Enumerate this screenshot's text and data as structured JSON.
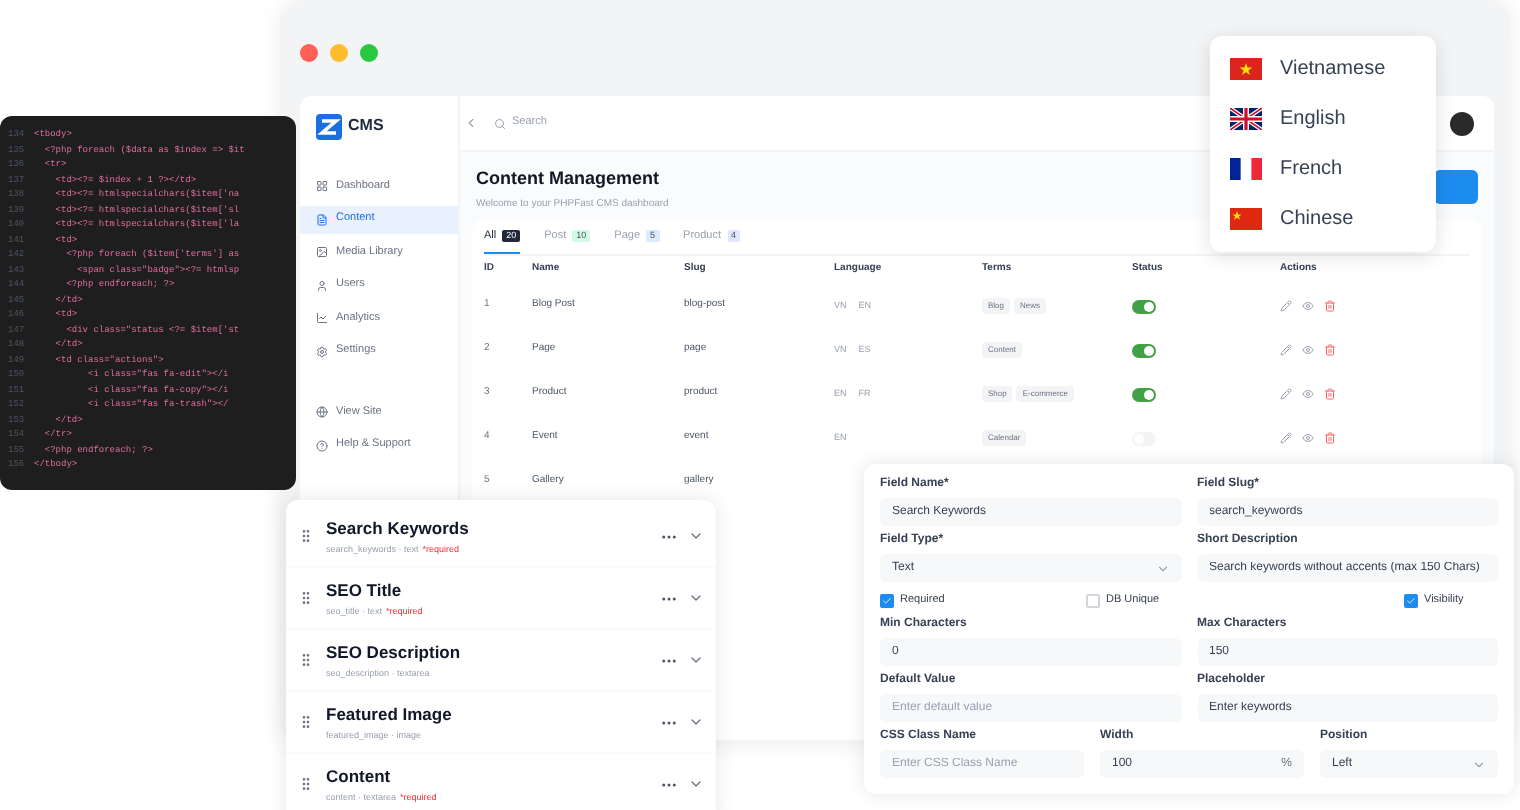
{
  "code_editor": {
    "lines": [
      {
        "number": "134",
        "text": "<tbody>"
      },
      {
        "number": "135",
        "text": "  <?php foreach ($data as $index => $it"
      },
      {
        "number": "136",
        "text": "  <tr>"
      },
      {
        "number": "137",
        "text": "    <td><?= $index + 1 ?></td>"
      },
      {
        "number": "138",
        "text": "    <td><?= htmlspecialchars($item['na"
      },
      {
        "number": "139",
        "text": "    <td><?= htmlspecialchars($item['sl"
      },
      {
        "number": "140",
        "text": "    <td><?= htmlspecialchars($item['la"
      },
      {
        "number": "141",
        "text": "    <td>"
      },
      {
        "number": "142",
        "text": "      <?php foreach ($item['terms'] as"
      },
      {
        "number": "143",
        "text": "        <span class=\"badge\"><?= htmlsp"
      },
      {
        "number": "144",
        "text": "      <?php endforeach; ?>"
      },
      {
        "number": "145",
        "text": "    </td>"
      },
      {
        "number": "146",
        "text": "    <td>"
      },
      {
        "number": "147",
        "text": "      <div class=\"status <?= $item['st"
      },
      {
        "number": "148",
        "text": "    </td>"
      },
      {
        "number": "149",
        "text": "    <td class=\"actions\">"
      },
      {
        "number": "150",
        "text": "          <i class=\"fas fa-edit\"></i"
      },
      {
        "number": "151",
        "text": "          <i class=\"fas fa-copy\"></i"
      },
      {
        "number": "152",
        "text": "          <i class=\"fas fa-trash\"></"
      },
      {
        "number": "153",
        "text": "    </td>"
      },
      {
        "number": "154",
        "text": "  </tr>"
      },
      {
        "number": "155",
        "text": "  <?php endforeach; ?>"
      },
      {
        "number": "156",
        "text": "</tbody>"
      }
    ]
  },
  "cms": {
    "logo": "CMS",
    "search": {
      "placeholder": "Search"
    },
    "sidebar": {
      "items": [
        {
          "label": "Dashboard",
          "selected": false
        },
        {
          "label": "Content",
          "selected": true
        },
        {
          "label": "Media Library",
          "selected": false
        },
        {
          "label": "Users",
          "selected": false
        },
        {
          "label": "Analytics",
          "selected": false
        },
        {
          "label": "Settings",
          "selected": false
        }
      ],
      "footer_items": [
        {
          "label": "View Site"
        },
        {
          "label": "Help & Support"
        }
      ]
    },
    "title": "Content Management",
    "subtitle": "Welcome to your PHPFast CMS dashboard",
    "tabs": [
      {
        "label": "All",
        "count": "20",
        "selected": true,
        "color": "#1f2937"
      },
      {
        "label": "Post",
        "count": "10",
        "selected": false,
        "color": "#d1fae5"
      },
      {
        "label": "Page",
        "count": "5",
        "selected": false,
        "color": "#dbeafe"
      },
      {
        "label": "Product",
        "count": "4",
        "selected": false,
        "color": "#e0e7ff"
      }
    ],
    "table": {
      "columns": [
        "ID",
        "Name",
        "Slug",
        "Language",
        "Terms",
        "Status",
        "Actions"
      ],
      "rows": [
        {
          "id": "1",
          "name": "Blog Post",
          "slug": "blog-post",
          "languages": [
            "VN",
            "EN"
          ],
          "terms": [
            "Blog",
            "News"
          ],
          "on": true
        },
        {
          "id": "2",
          "name": "Page",
          "slug": "page",
          "languages": [
            "VN",
            "ES"
          ],
          "terms": [
            "Content"
          ],
          "on": true
        },
        {
          "id": "3",
          "name": "Product",
          "slug": "product",
          "languages": [
            "EN",
            "FR"
          ],
          "terms": [
            "Shop",
            "E-commerce"
          ],
          "on": true
        },
        {
          "id": "4",
          "name": "Event",
          "slug": "event",
          "languages": [
            "EN"
          ],
          "terms": [
            "Calendar"
          ],
          "on": false
        },
        {
          "id": "5",
          "name": "Gallery",
          "slug": "gallery"
        }
      ]
    }
  },
  "language_menu": {
    "items": [
      {
        "label": "Vietnamese",
        "kind": "vietnam"
      },
      {
        "label": "English",
        "kind": "uk"
      },
      {
        "label": "French",
        "kind": "france"
      },
      {
        "label": "Chinese",
        "kind": "china"
      }
    ]
  },
  "fields": [
    {
      "title": "Search Keywords",
      "meta": "search_keywords · text",
      "required": "*required"
    },
    {
      "title": "SEO Title",
      "meta": "seo_title · text",
      "required": "*required"
    },
    {
      "title": "SEO Description",
      "meta": "seo_description · textarea"
    },
    {
      "title": "Featured Image",
      "meta": "featured_image · image"
    },
    {
      "title": "Content",
      "meta": "content · textarea",
      "required": "*required"
    }
  ],
  "field_form": {
    "field_name": {
      "label": "Field Name*",
      "value": "Search Keywords"
    },
    "field_slug": {
      "label": "Field Slug*",
      "value": "search_keywords"
    },
    "field_type": {
      "label": "Field Type*",
      "value": "Text"
    },
    "short_description": {
      "label": "Short Description",
      "value": "Search keywords without accents (max 150 Chars)"
    },
    "checkboxes": [
      {
        "label": "Required",
        "checked": true
      },
      {
        "label": "DB Unique",
        "checked": false
      },
      {
        "label": "Visibility",
        "checked": true
      }
    ],
    "min_characters": {
      "label": "Min Characters",
      "value": "0"
    },
    "max_characters": {
      "label": "Max Characters",
      "value": "150"
    },
    "default_value": {
      "label": "Default Value",
      "placeholder": "Enter default value"
    },
    "placeholder": {
      "label": "Placeholder",
      "value": "Enter keywords"
    },
    "css_class": {
      "label": "CSS Class Name",
      "placeholder": "Enter CSS Class Name"
    },
    "width": {
      "label": "Width",
      "value": "100",
      "unit": "%"
    },
    "position": {
      "label": "Position",
      "value": "Left"
    }
  }
}
